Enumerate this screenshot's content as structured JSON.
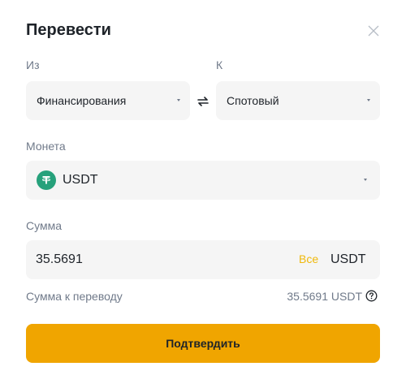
{
  "dialog": {
    "title": "Перевести",
    "close_icon": "close-icon"
  },
  "from": {
    "label": "Из",
    "value": "Финансирования"
  },
  "to": {
    "label": "К",
    "value": "Спотовый"
  },
  "swap_icon": "swap-arrows-icon",
  "coin": {
    "label": "Монета",
    "value": "USDT",
    "icon": "tether-icon",
    "icon_color": "#26a17b"
  },
  "amount": {
    "label": "Сумма",
    "value": "35.5691",
    "all_label": "Все",
    "unit": "USDT"
  },
  "transfer_sum": {
    "label": "Сумма к переводу",
    "value": "35.5691 USDT"
  },
  "confirm": {
    "label": "Подтвердить",
    "color": "#f0a500"
  },
  "colors": {
    "accent": "#f0b90b",
    "field_bg": "#f5f5f5",
    "muted_text": "#707a8a"
  }
}
